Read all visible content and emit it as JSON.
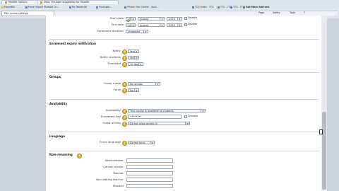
{
  "browser": {
    "tabs": [
      "Moodle Options",
      "Sites: Pre-login suggestion for Moodle"
    ],
    "bookmarks": [
      "Favorites",
      "Force Import Multiple Ch...",
      "My WordLink",
      "FirstLight ...",
      "iPhone Dev Center - Appl...",
      "TTQ Index - TTQ",
      "TTQ - TTQ",
      "TTQ - TTQ",
      "Get More Add-ons"
    ],
    "address_tab": "Edit course settings",
    "toolbar": [
      "Page",
      "Safety",
      "Tools",
      "?"
    ]
  },
  "form": {
    "dates": [
      {
        "label": "Start date",
        "day": "20",
        "month": "August",
        "year": "2010"
      },
      {
        "label": "End date",
        "day": "20",
        "month": "August",
        "year": "2010"
      }
    ],
    "disable_label": "Disable",
    "duration": {
      "label": "Enrolment duration",
      "value": "Unlimited"
    },
    "expiry_section": "Enrolment expiry notification",
    "notify": {
      "label": "Notify",
      "value": "Yes"
    },
    "notify_students": {
      "label": "Notify students",
      "value": "Yes"
    },
    "threshold": {
      "label": "Threshold",
      "value": "10 days"
    },
    "groups_section": "Groups",
    "group_mode": {
      "label": "Group mode",
      "value": "No groups"
    },
    "force": {
      "label": "Force",
      "value": "No"
    },
    "availability_section": "Availability",
    "availability": {
      "label": "Availability",
      "value": "This course is available to students"
    },
    "enrolment_key": {
      "label": "Enrolment key",
      "value": "••••••••",
      "unmask": "Unmask"
    },
    "guest_access": {
      "label": "Guest access",
      "value": "Do not allow guests in"
    },
    "language_section": "Language",
    "force_language": {
      "label": "Force language",
      "value": "Do not force"
    },
    "roles_section": "Role renaming",
    "roles": [
      "Administrator",
      "Course creator",
      "Teacher",
      "Non-editing teacher",
      "Student"
    ]
  }
}
